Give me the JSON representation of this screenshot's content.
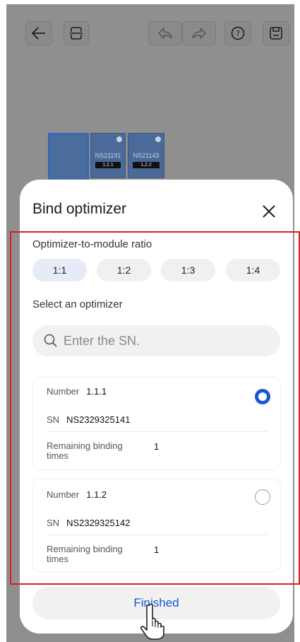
{
  "toolbar": {
    "icons": [
      "back-arrow-icon",
      "scan-frame-icon",
      "undo-icon",
      "redo-icon",
      "help-icon",
      "save-icon"
    ]
  },
  "background_modules": [
    {
      "sn": "NS21191",
      "tag": "1.2.1"
    },
    {
      "sn": "NS21143",
      "tag": "1.2.2"
    }
  ],
  "sheet": {
    "title": "Bind optimizer",
    "ratio_label": "Optimizer-to-module ratio",
    "ratios": [
      "1:1",
      "1:2",
      "1:3",
      "1:4"
    ],
    "selected_ratio": "1:1",
    "select_label": "Select an optimizer",
    "search_placeholder": "Enter the SN.",
    "cards": [
      {
        "number_label": "Number",
        "number": "1.1.1",
        "sn_label": "SN",
        "sn": "NS2329325141",
        "remaining_label": "Remaining binding times",
        "remaining": "1",
        "selected": true
      },
      {
        "number_label": "Number",
        "number": "1.1.2",
        "sn_label": "SN",
        "sn": "NS2329325142",
        "remaining_label": "Remaining binding times",
        "remaining": "1",
        "selected": false
      }
    ],
    "finish_label": "Finished"
  },
  "colors": {
    "accent": "#1a57d6",
    "highlight": "#d91f26",
    "backdrop": "#8f8f8f"
  }
}
